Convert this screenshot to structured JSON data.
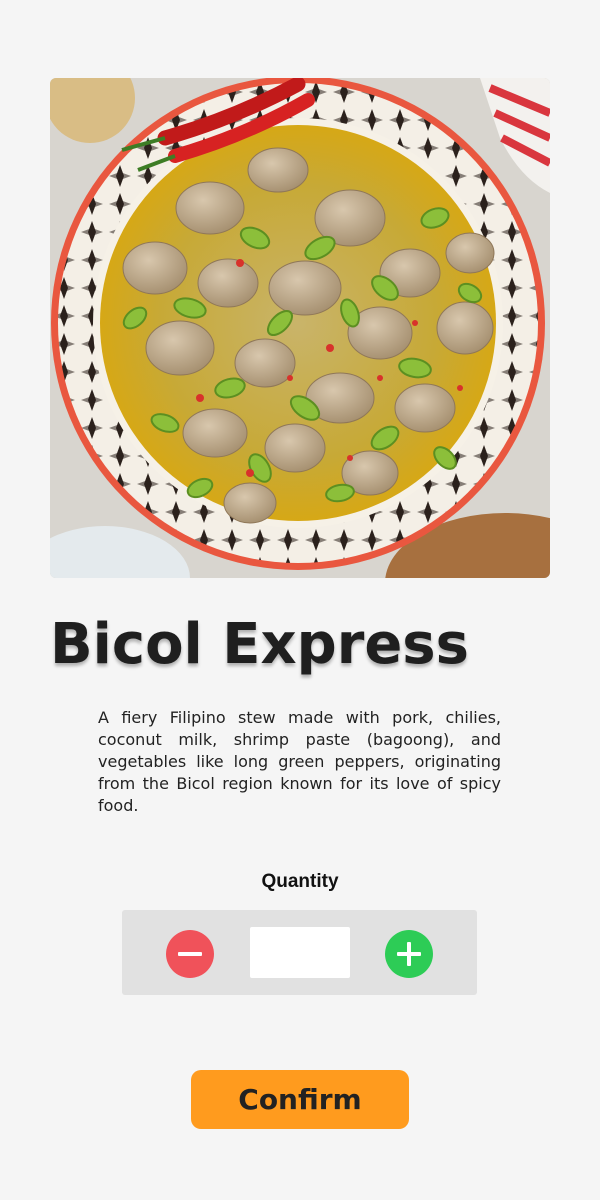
{
  "dish": {
    "image_alt": "Bicol Express dish in a patterned bowl",
    "title": "Bicol Express",
    "description": "A fiery Filipino stew made with pork, chilies, coconut milk, shrimp paste (bagoong), and vegetables like long green peppers, originating from the Bicol region known for its love of spicy food."
  },
  "quantity": {
    "label": "Quantity",
    "value": "",
    "decrement_icon": "minus-icon",
    "increment_icon": "plus-icon"
  },
  "actions": {
    "confirm_label": "Confirm"
  },
  "colors": {
    "background": "#f5f5f5",
    "decrement": "#f0525a",
    "increment": "#2dcc56",
    "confirm": "#ff9b1e",
    "quantity_panel": "#e1e1e1"
  }
}
